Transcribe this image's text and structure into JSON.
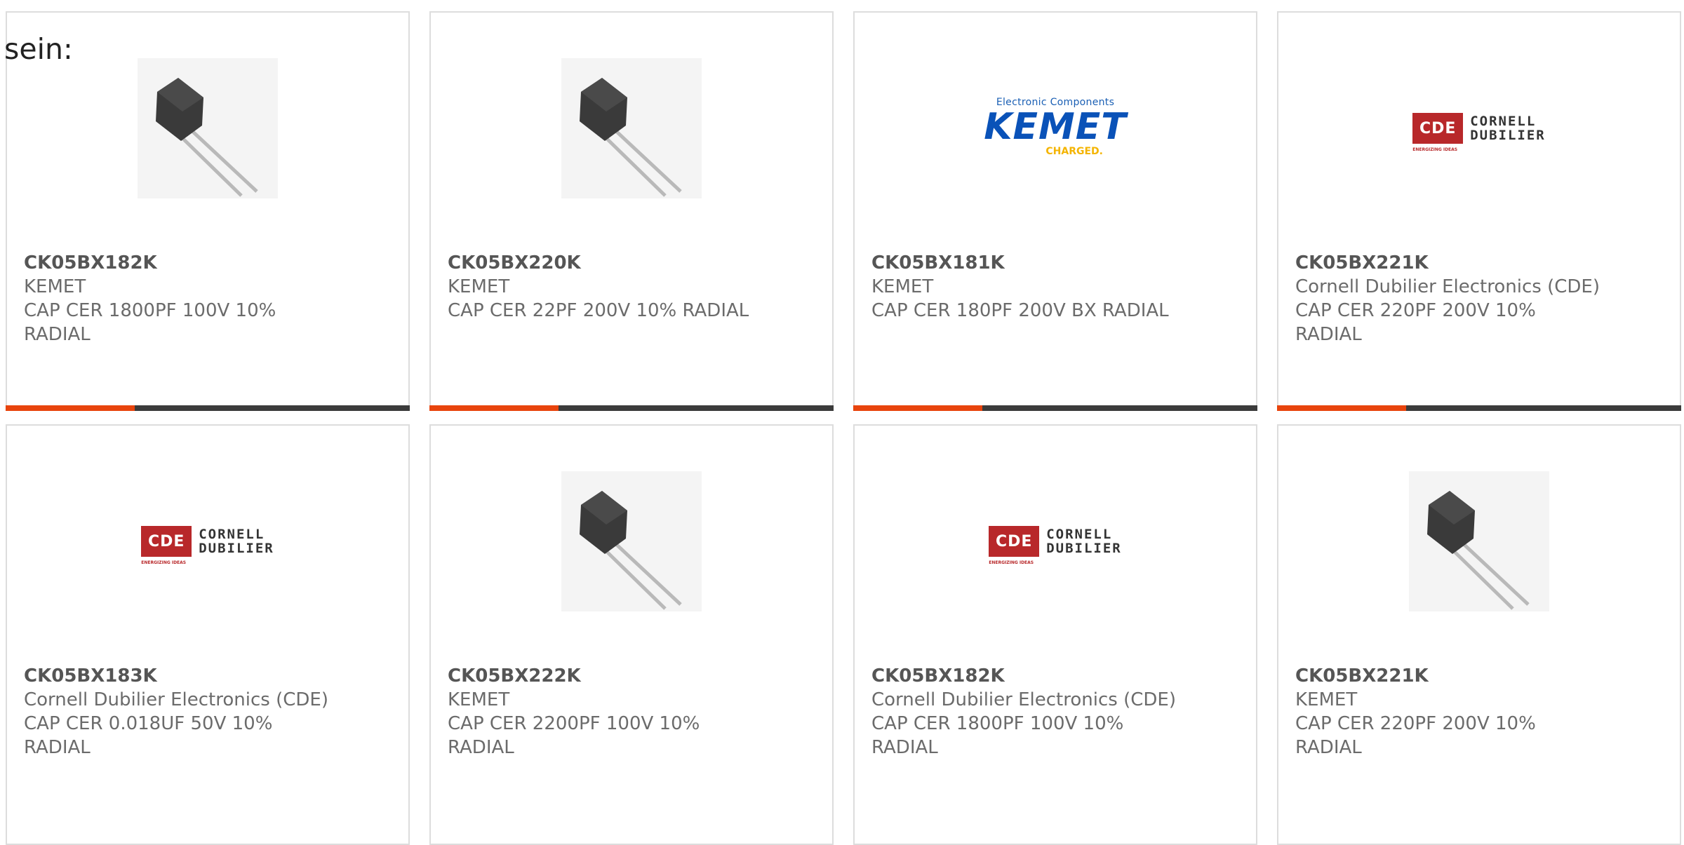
{
  "intro_text": "sein:",
  "colors": {
    "accent_bar": "#e8440d",
    "dark_bar": "#3b3b3b",
    "kemet_blue": "#0a52b8",
    "kemet_yellow": "#f4b400",
    "cde_red": "#b8282a"
  },
  "logos": {
    "kemet": {
      "tagline": "Electronic Components",
      "name": "KEMET",
      "slogan": "CHARGED."
    },
    "cde": {
      "mark": "CDE",
      "line1": "CORNELL",
      "line2": "DUBILIER",
      "small": "ENERGIZING IDEAS"
    }
  },
  "products": [
    {
      "part_number": "CK05BX182K",
      "manufacturer": "KEMET",
      "desc_line1": "CAP CER 1800PF 100V 10%",
      "desc_line2": "RADIAL",
      "image": "capacitor-photo"
    },
    {
      "part_number": "CK05BX220K",
      "manufacturer": "KEMET",
      "desc_line1": "CAP CER 22PF 200V 10% RADIAL",
      "desc_line2": "",
      "image": "capacitor-photo"
    },
    {
      "part_number": "CK05BX181K",
      "manufacturer": "KEMET",
      "desc_line1": "CAP CER 180PF 200V BX RADIAL",
      "desc_line2": "",
      "image": "kemet-logo"
    },
    {
      "part_number": "CK05BX221K",
      "manufacturer": "Cornell Dubilier Electronics (CDE)",
      "desc_line1": "CAP CER 220PF 200V 10%",
      "desc_line2": "RADIAL",
      "image": "cde-logo"
    },
    {
      "part_number": "CK05BX183K",
      "manufacturer": "Cornell Dubilier Electronics (CDE)",
      "desc_line1": "CAP CER 0.018UF 50V 10%",
      "desc_line2": "RADIAL",
      "image": "cde-logo"
    },
    {
      "part_number": "CK05BX222K",
      "manufacturer": "KEMET",
      "desc_line1": "CAP CER 2200PF 100V 10%",
      "desc_line2": "RADIAL",
      "image": "capacitor-photo"
    },
    {
      "part_number": "CK05BX182K",
      "manufacturer": "Cornell Dubilier Electronics (CDE)",
      "desc_line1": "CAP CER 1800PF 100V 10%",
      "desc_line2": "RADIAL",
      "image": "cde-logo"
    },
    {
      "part_number": "CK05BX221K",
      "manufacturer": "KEMET",
      "desc_line1": "CAP CER 220PF 200V 10%",
      "desc_line2": "RADIAL",
      "image": "capacitor-photo"
    }
  ]
}
